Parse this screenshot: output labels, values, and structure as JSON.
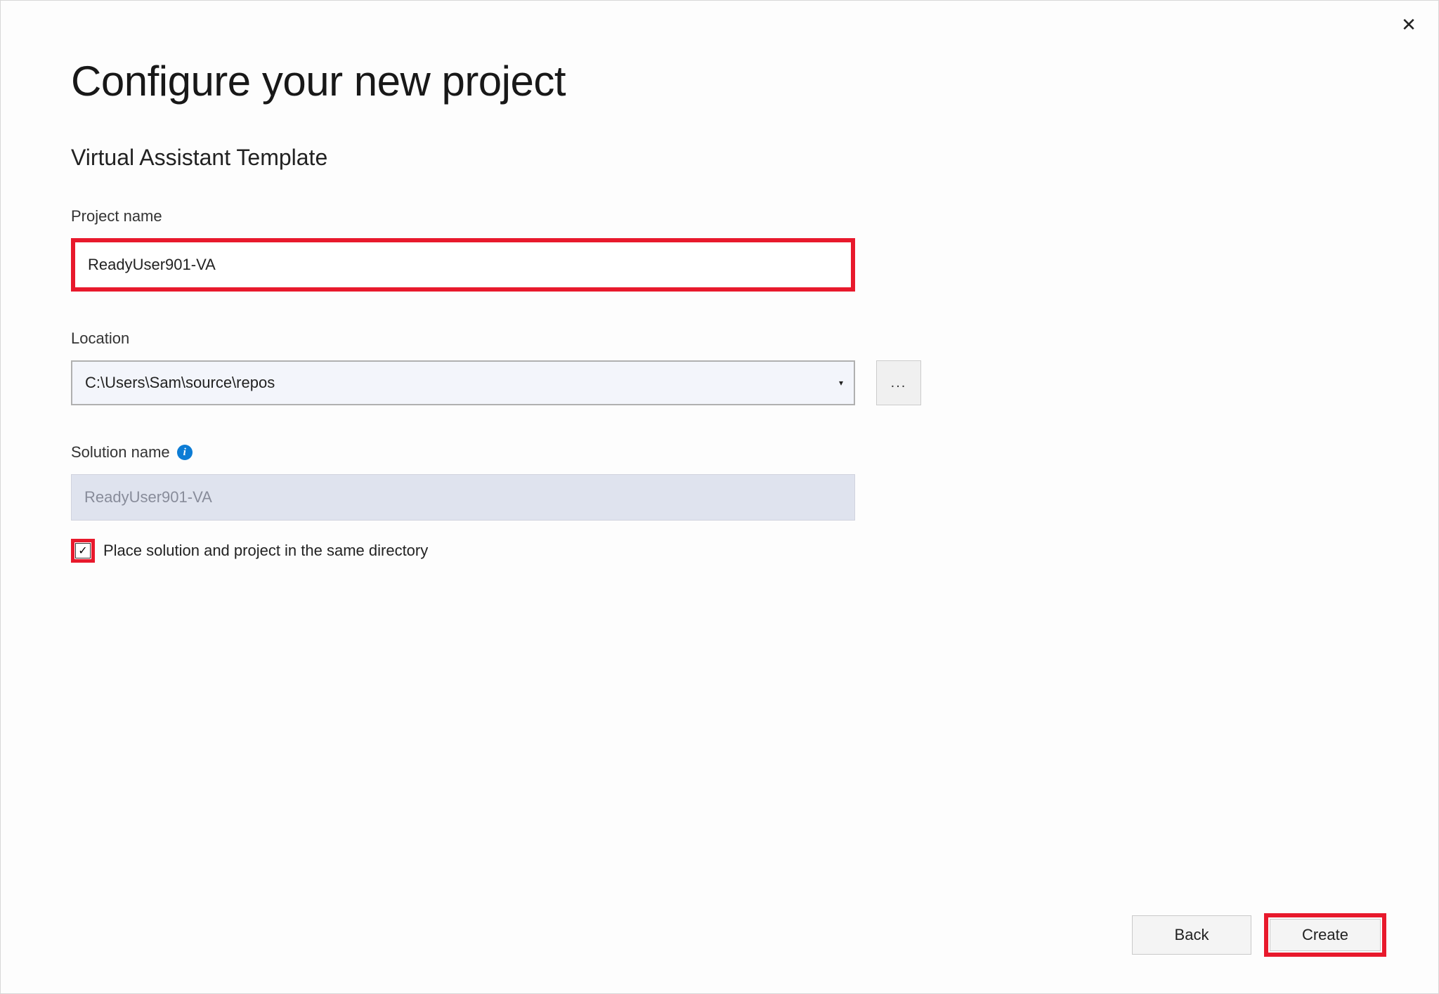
{
  "dialog": {
    "title": "Configure your new project",
    "subtitle": "Virtual Assistant Template",
    "closeGlyph": "✕"
  },
  "projectName": {
    "label": "Project name",
    "value": "ReadyUser901-VA"
  },
  "location": {
    "label": "Location",
    "value": "C:\\Users\\Sam\\source\\repos",
    "browseLabel": "...",
    "caretGlyph": "▾"
  },
  "solutionName": {
    "label": "Solution name",
    "value": "ReadyUser901-VA"
  },
  "sameDirectory": {
    "label": "Place solution and project in the same directory",
    "checked": true,
    "checkGlyph": "✓"
  },
  "buttons": {
    "back": "Back",
    "create": "Create"
  }
}
